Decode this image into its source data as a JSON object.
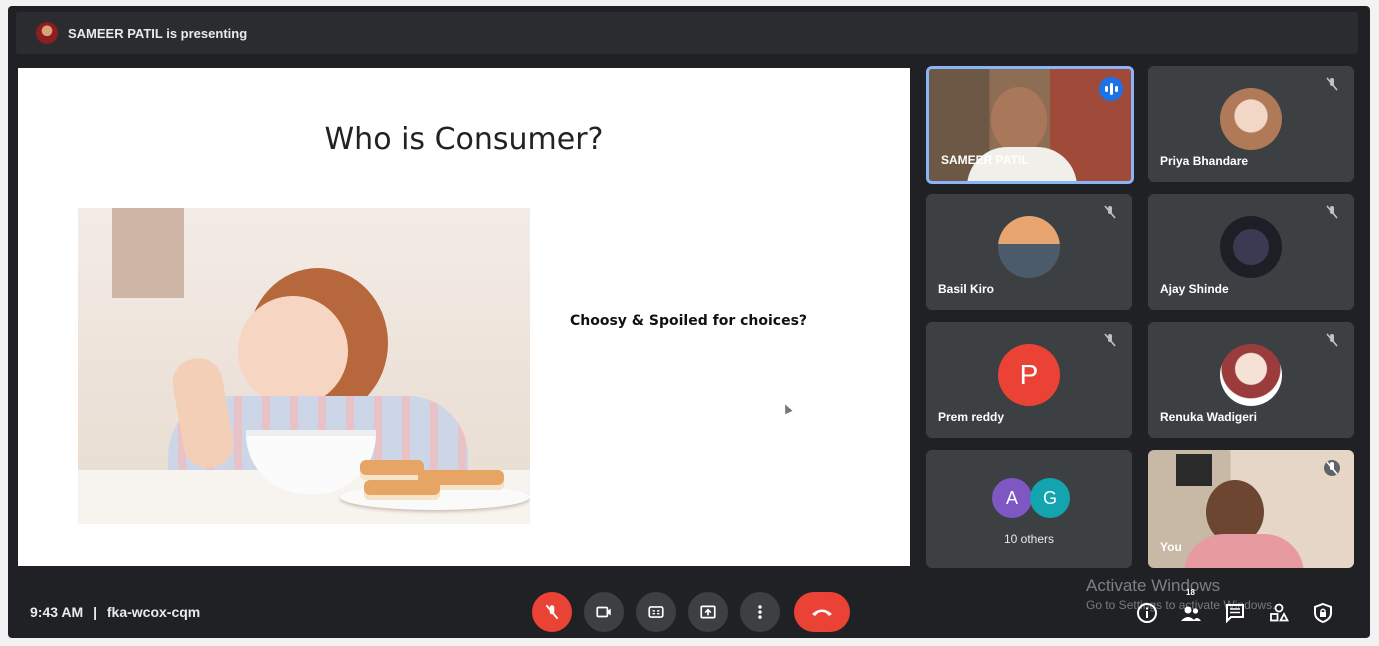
{
  "topbar": {
    "presenting_text": "SAMEER PATIL is presenting"
  },
  "slide": {
    "title": "Who is Consumer?",
    "caption": "Choosy & Spoiled for choices?"
  },
  "participants": [
    {
      "name": "SAMEER PATIL",
      "speaking": true
    },
    {
      "name": "Priya Bhandare",
      "muted": true
    },
    {
      "name": "Basil Kiro",
      "muted": true
    },
    {
      "name": "Ajay Shinde",
      "muted": true
    },
    {
      "name": "Prem reddy",
      "muted": true,
      "initial": "P",
      "color": "#ea4335"
    },
    {
      "name": "Renuka Wadigeri",
      "muted": true
    },
    {
      "name": "10 others",
      "initials": [
        "A",
        "G"
      ],
      "colors": [
        "#7e57c2",
        "#12a4af"
      ]
    },
    {
      "name": "You",
      "muted": true
    }
  ],
  "bottombar": {
    "time": "9:43 AM",
    "separator": "|",
    "meeting_code": "fka-wcox-cqm",
    "people_count": "18"
  },
  "watermark": {
    "title": "Activate Windows",
    "subtitle": "Go to Settings to activate Windows."
  },
  "colors": {
    "accent": "#8ab4f8",
    "danger": "#ea4335",
    "background": "#202124",
    "tile": "#3c4043"
  }
}
